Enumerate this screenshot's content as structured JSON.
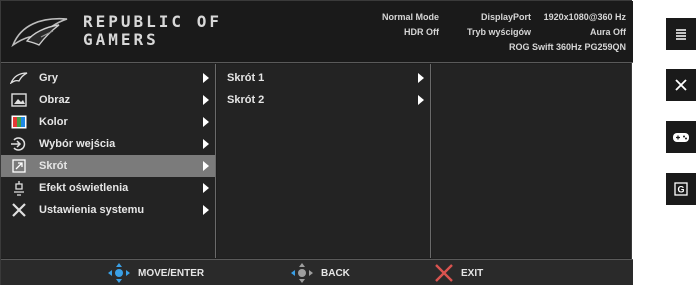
{
  "header": {
    "brand_line1": "REPUBLIC OF",
    "brand_line2": "GAMERS",
    "mode": "Normal Mode",
    "hdr": "HDR Off",
    "input_port": "DisplayPort",
    "input_mode": "Tryb wyścigów",
    "resolution": "1920x1080@360 Hz",
    "aura": "Aura Off",
    "model": "ROG Swift 360Hz PG259QN"
  },
  "menu": {
    "items": [
      {
        "label": "Gry",
        "icon": "gamepad-blade-icon"
      },
      {
        "label": "Obraz",
        "icon": "image-icon"
      },
      {
        "label": "Kolor",
        "icon": "color-icon"
      },
      {
        "label": "Wybór wejścia",
        "icon": "input-icon"
      },
      {
        "label": "Skrót",
        "icon": "shortcut-icon",
        "active": true
      },
      {
        "label": "Efekt oświetlenia",
        "icon": "lighting-icon"
      },
      {
        "label": "Ustawienia systemu",
        "icon": "tools-icon"
      }
    ]
  },
  "submenu": {
    "items": [
      {
        "label": "Skrót 1"
      },
      {
        "label": "Skrót 2"
      }
    ]
  },
  "footer": {
    "move_label": "MOVE/ENTER",
    "back_label": "BACK",
    "exit_label": "EXIT"
  },
  "side_keys": [
    "menu-icon",
    "close-icon",
    "gamepad-icon",
    "gameplus-icon"
  ],
  "side_key_gameplus_label": "G",
  "colors": {
    "accent_blue": "#3aa0e6",
    "active_row": "#7b7b7b",
    "exit_red": "#d9534f"
  }
}
